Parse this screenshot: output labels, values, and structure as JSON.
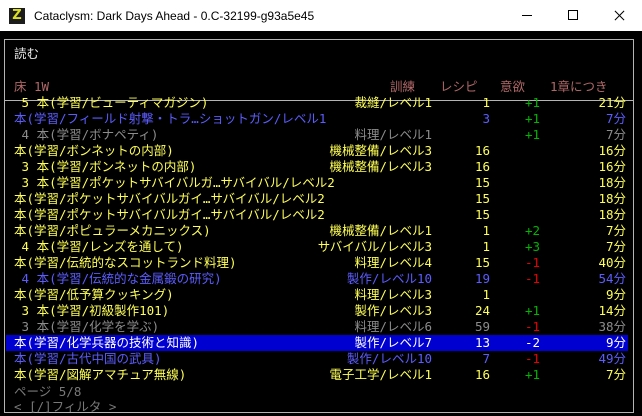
{
  "window": {
    "title": "Cataclysm: Dark Days Ahead - 0.C-32199-g93a5e45",
    "icon_letter": "Z",
    "icon_color": "#d9e021"
  },
  "menu": {
    "title": "読む",
    "header": {
      "floor": "床 1W",
      "train": "訓練",
      "recipe": "レシピ",
      "fun": "意欲",
      "time": "1章につき"
    },
    "footer": {
      "page": "ページ 5/8",
      "filter": "< [/]フィルタ >"
    },
    "colors": {
      "yellow": "#ffff55",
      "blue": "#5c5cff",
      "gray": "#8c8c8c",
      "header": "#b06868",
      "positive": "#00b400",
      "negative": "#e80000",
      "selection": "#0000d0"
    },
    "items": [
      {
        "name": " 5 本(学習/ビューティマガジン)",
        "skill": "裁縫/レベル1",
        "recipes": "1",
        "fun": "+1",
        "time": "21分",
        "color": "yellow",
        "fun_color": "green"
      },
      {
        "name": "本(学習/フィールド射撃・トラ…ショットガン/レベル1",
        "skill": "",
        "recipes": "3",
        "fun": "+1",
        "time": "7分",
        "color": "blue",
        "fun_color": "green"
      },
      {
        "name": " 4 本(学習/ボナペティ)",
        "skill": "料理/レベル1",
        "recipes": "",
        "fun": "+1",
        "time": "7分",
        "color": "gray",
        "fun_color": "green"
      },
      {
        "name": "本(学習/ボンネットの内部)",
        "skill": "機械整備/レベル3",
        "recipes": "16",
        "fun": "",
        "time": "16分",
        "color": "yellow",
        "fun_color": "green"
      },
      {
        "name": " 3 本(学習/ボンネットの内部)",
        "skill": "機械整備/レベル3",
        "recipes": "16",
        "fun": "",
        "time": "16分",
        "color": "yellow",
        "fun_color": "green"
      },
      {
        "name": " 3 本(学習/ポケットサバイバルガ…サバイバル/レベル2",
        "skill": "",
        "recipes": "15",
        "fun": "",
        "time": "18分",
        "color": "yellow",
        "fun_color": "green"
      },
      {
        "name": "本(学習/ポケットサバイバルガイ…サバイバル/レベル2",
        "skill": "",
        "recipes": "15",
        "fun": "",
        "time": "18分",
        "color": "yellow",
        "fun_color": "green"
      },
      {
        "name": "本(学習/ポケットサバイバルガイ…サバイバル/レベル2",
        "skill": "",
        "recipes": "15",
        "fun": "",
        "time": "18分",
        "color": "yellow",
        "fun_color": "green"
      },
      {
        "name": "本(学習/ポピュラーメカニックス)",
        "skill": "機械整備/レベル1",
        "recipes": "1",
        "fun": "+2",
        "time": "7分",
        "color": "yellow",
        "fun_color": "green"
      },
      {
        "name": " 4 本(学習/レンズを通して)",
        "skill": "サバイバル/レベル3",
        "recipes": "1",
        "fun": "+3",
        "time": "7分",
        "color": "yellow",
        "fun_color": "green"
      },
      {
        "name": "本(学習/伝統的なスコットランド料理)",
        "skill": "料理/レベル4",
        "recipes": "15",
        "fun": "-1",
        "time": "40分",
        "color": "yellow",
        "fun_color": "red"
      },
      {
        "name": " 4 本(学習/伝統的な金属鍛の研究)",
        "skill": "製作/レベル10",
        "recipes": "19",
        "fun": "-1",
        "time": "54分",
        "color": "blue",
        "fun_color": "red"
      },
      {
        "name": "本(学習/低予算クッキング)",
        "skill": "料理/レベル3",
        "recipes": "1",
        "fun": "",
        "time": "9分",
        "color": "yellow",
        "fun_color": "green"
      },
      {
        "name": " 3 本(学習/初級製作101)",
        "skill": "製作/レベル3",
        "recipes": "24",
        "fun": "+1",
        "time": "14分",
        "color": "yellow",
        "fun_color": "green"
      },
      {
        "name": " 3 本(学習/化学を学ぶ)",
        "skill": "料理/レベル6",
        "recipes": "59",
        "fun": "-1",
        "time": "38分",
        "color": "gray",
        "fun_color": "red"
      },
      {
        "name": "本(学習/化学兵器の技術と知識)",
        "skill": "製作/レベル7",
        "recipes": "13",
        "fun": "-2",
        "time": "9分",
        "color": "yellow",
        "fun_color": "red",
        "selected": true
      },
      {
        "name": "本(学習/古代中国の武具)",
        "skill": "製作/レベル10",
        "recipes": "7",
        "fun": "-1",
        "time": "49分",
        "color": "blue",
        "fun_color": "red"
      },
      {
        "name": "本(学習/図解アマチュア無線)",
        "skill": "電子工学/レベル1",
        "recipes": "16",
        "fun": "+1",
        "time": "7分",
        "color": "yellow",
        "fun_color": "green"
      }
    ]
  }
}
